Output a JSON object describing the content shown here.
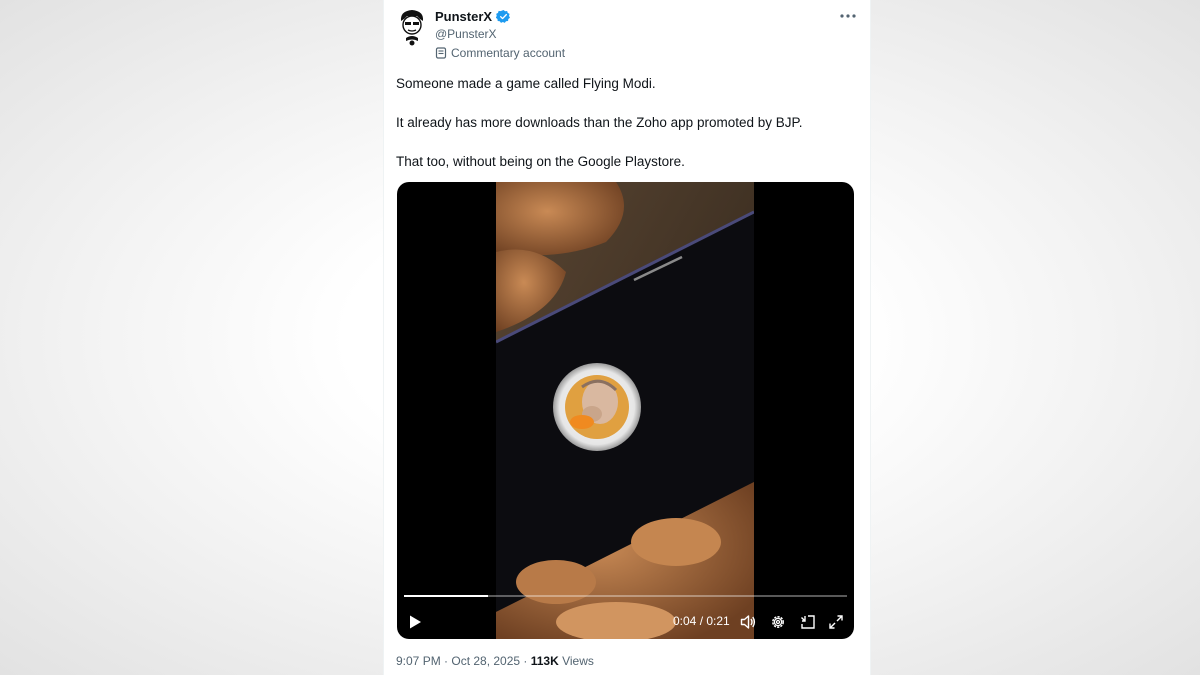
{
  "post": {
    "author": {
      "display_name": "PunsterX",
      "handle": "@PunsterX",
      "verified": true,
      "account_label": "Commentary account"
    },
    "text_lines": [
      "Someone made a game called Flying Modi.",
      "It already has more downloads than the Zoho app promoted by BJP.",
      "That too, without being on the Google Playstore."
    ],
    "video": {
      "current_time": "0:04",
      "time_separator": " / ",
      "duration": "0:21",
      "progress_fraction": 0.19
    },
    "footer": {
      "time_date": "9:07 PM · Oct 28, 2025 · ",
      "views_count": "113K",
      "views_label": " Views"
    }
  },
  "icons": {
    "more": "more-dots-icon",
    "verified": "verified-badge-icon",
    "label": "government-badge-icon",
    "play": "play-icon",
    "volume": "volume-icon",
    "settings": "gear-icon",
    "exit": "exit-video-icon",
    "fullscreen": "fullscreen-icon"
  },
  "colors": {
    "verified_blue": "#1d9bf0",
    "text_primary": "#0f1419",
    "text_secondary": "#536471"
  }
}
